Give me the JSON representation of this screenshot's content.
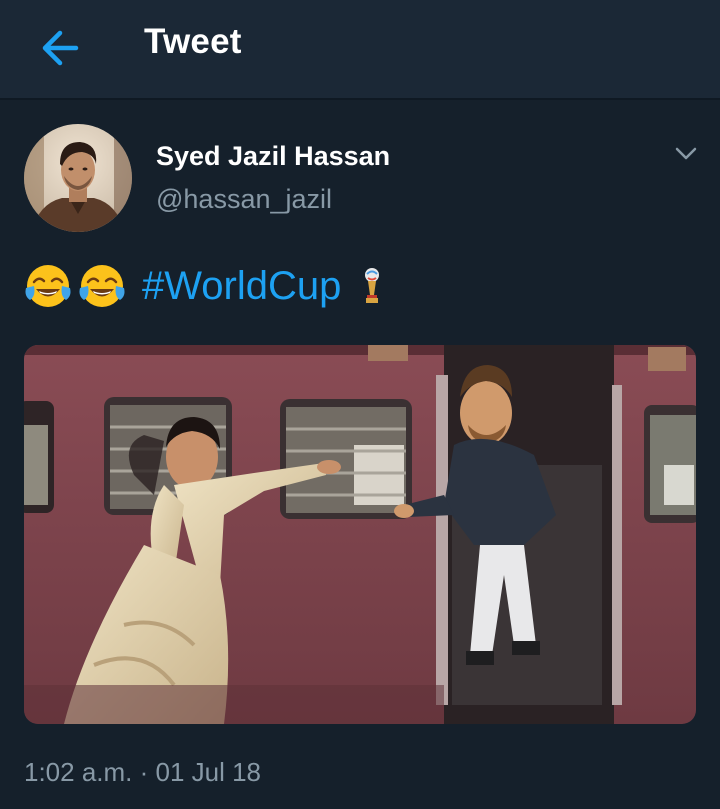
{
  "header": {
    "title": "Tweet",
    "back_icon": "arrow-left-icon"
  },
  "tweet": {
    "author": {
      "display_name": "Syed Jazil Hassan",
      "handle": "@hassan_jazil"
    },
    "text": {
      "emojis": [
        "face-with-tears-of-joy",
        "face-with-tears-of-joy"
      ],
      "hashtag": "#WorldCup",
      "hashtag_emoji": "world-cup-trophy"
    },
    "media": {
      "kind": "photo",
      "description_icon": "train-meme-photo"
    },
    "timestamp": "1:02 a.m. · 01 Jul 18"
  },
  "colors": {
    "background": "#15202b",
    "header_bg": "#1b2836",
    "accent": "#1da1f2",
    "secondary_text": "#8899a6"
  }
}
